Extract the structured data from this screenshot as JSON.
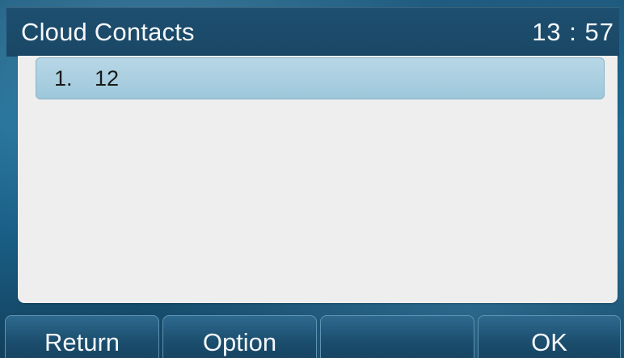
{
  "header": {
    "title": "Cloud Contacts",
    "time": "13 : 57"
  },
  "list": {
    "items": [
      {
        "index": "1.",
        "name": "12",
        "selected": true
      }
    ]
  },
  "softkeys": {
    "return_label": "Return",
    "option_label": "Option",
    "empty_label": "",
    "ok_label": "OK"
  },
  "colors": {
    "header_bg": "#1e4f70",
    "content_bg": "#eeeeee",
    "selection_bg": "#a9cfe0",
    "softkey_bg": "#1b4d6d"
  }
}
